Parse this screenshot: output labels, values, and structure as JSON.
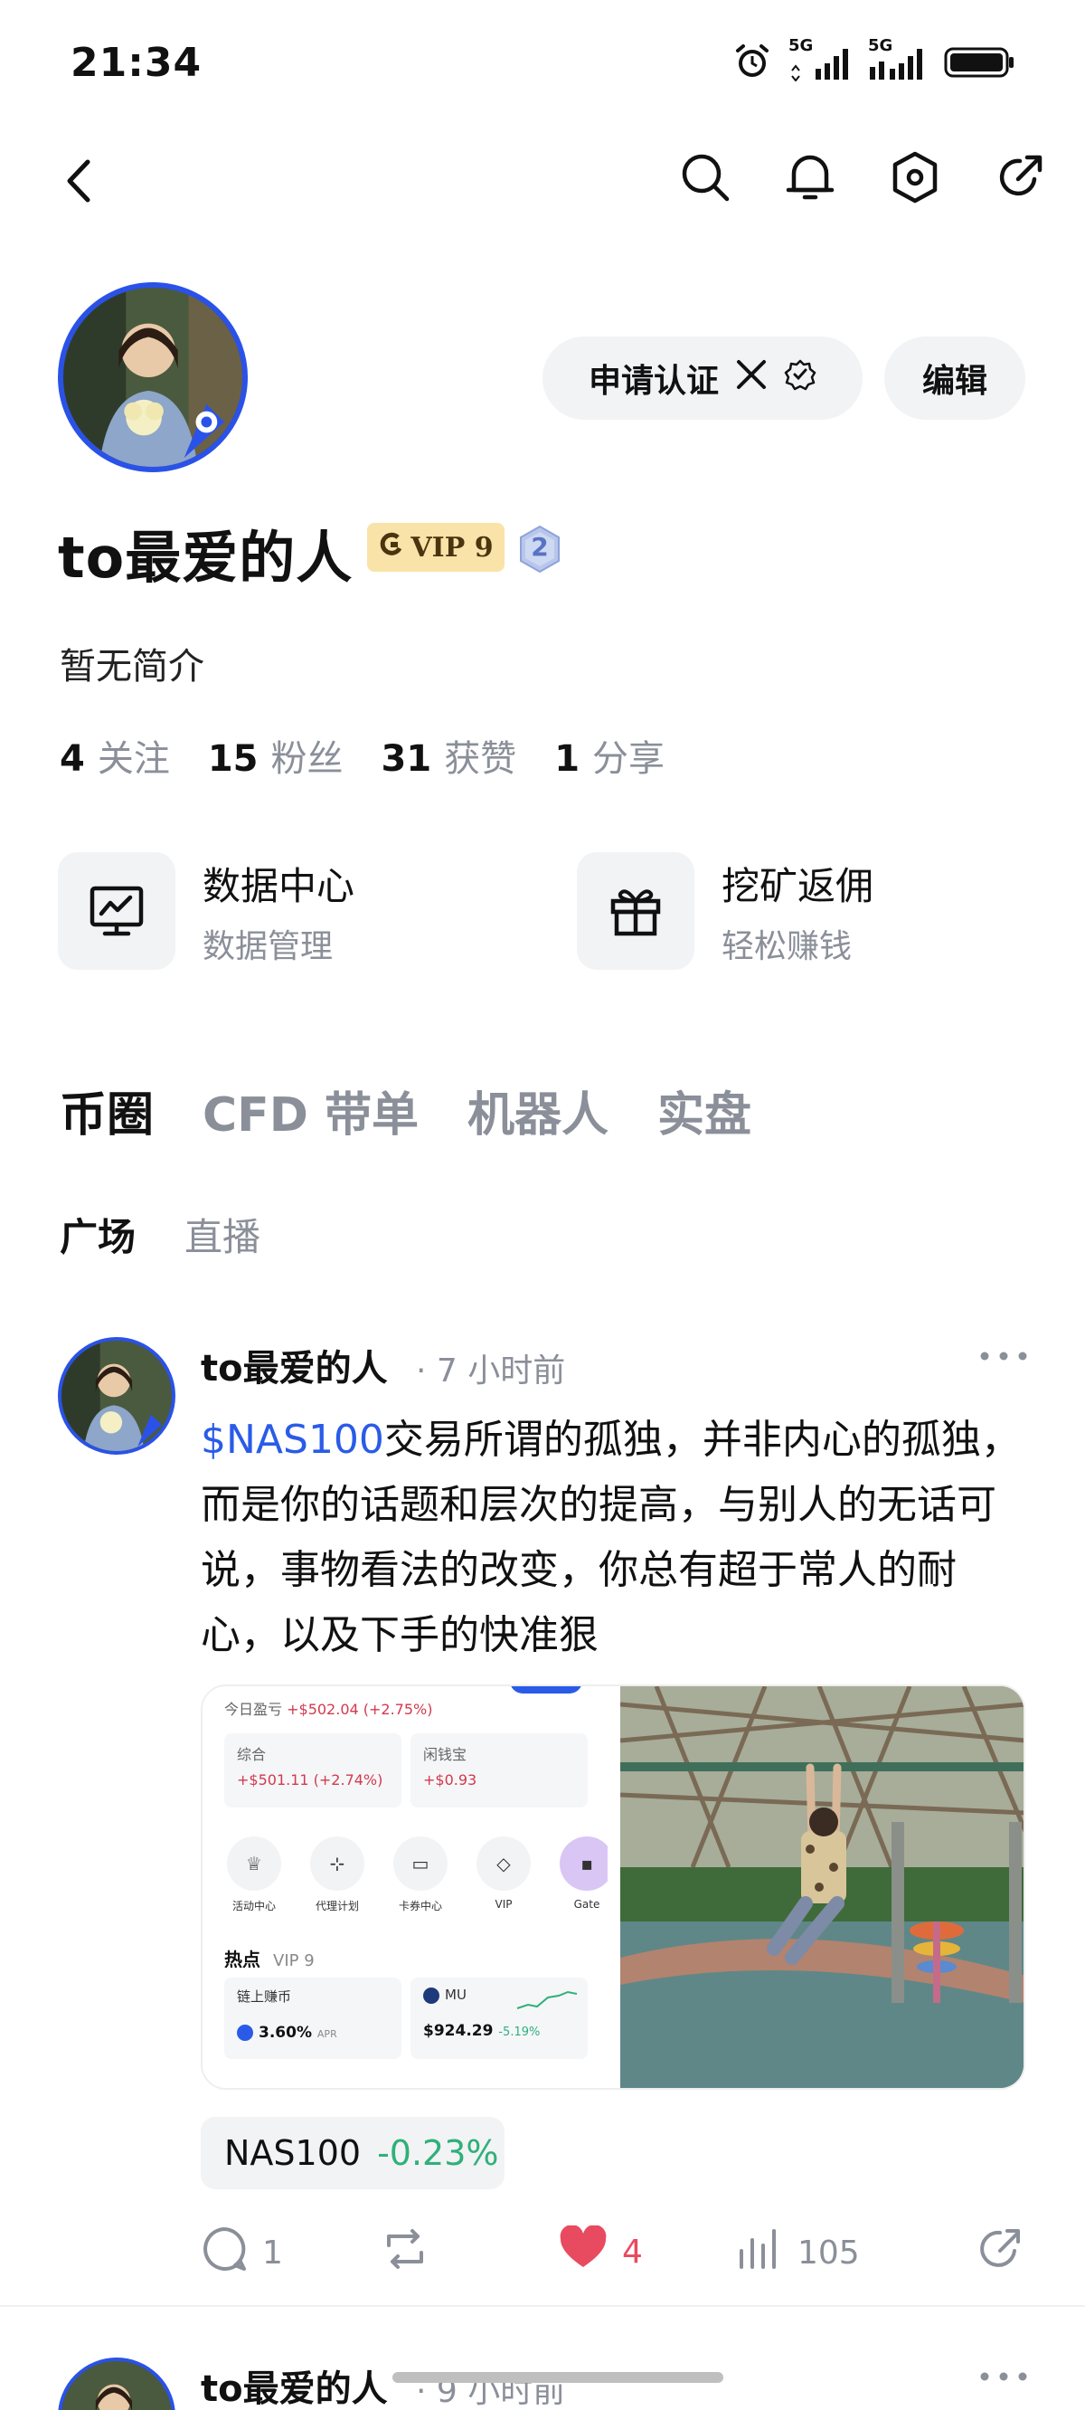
{
  "status_bar": {
    "time": "21:34",
    "signal_1_label": "5G",
    "signal_2_label": "5G"
  },
  "nav": {
    "icons": [
      "back-icon",
      "search-icon",
      "bell-icon",
      "settings-hex-icon",
      "share-icon"
    ]
  },
  "profile": {
    "name": "to最爱的人",
    "vip_label": "VIP 9",
    "level": "2",
    "bio": "暂无简介",
    "buttons": {
      "verify": "申请认证",
      "edit": "编辑"
    },
    "stats": [
      {
        "num": "4",
        "label": "关注"
      },
      {
        "num": "15",
        "label": "粉丝"
      },
      {
        "num": "31",
        "label": "获赞"
      },
      {
        "num": "1",
        "label": "分享"
      }
    ]
  },
  "tools": [
    {
      "title": "数据中心",
      "subtitle": "数据管理",
      "icon": "chart-monitor-icon"
    },
    {
      "title": "挖矿返佣",
      "subtitle": "轻松赚钱",
      "icon": "gift-icon"
    }
  ],
  "main_tabs": [
    "币圈",
    "CFD 带单",
    "机器人",
    "实盘"
  ],
  "sub_tabs": [
    "广场",
    "直播"
  ],
  "post": {
    "author": "to最爱的人",
    "time": "· 7 小时前",
    "ticker_link": "$NAS100",
    "text": "交易所谓的孤独，并非内心的孤独，而是你的话题和层次的提高，与别人的无话可说，事物看法的改变，你总有超于常人的耐心，以及下手的快准狠",
    "screenshot": {
      "pnl_label": "今日盈亏",
      "pnl_value": "+$502.04 (+2.75%)",
      "box1_label": "综合",
      "box1_value": "+$501.11 (+2.74%)",
      "box2_label": "闲钱宝",
      "box2_value": "+$0.93",
      "icons": [
        "活动中心",
        "代理计划",
        "卡券中心",
        "VIP",
        "Gate"
      ],
      "hot_label": "热点",
      "hot_vip": "VIP 9",
      "card1_title": "链上赚币",
      "card1_value": "3.60%",
      "card1_unit": "APR",
      "card2_title": "MU",
      "card2_value": "$924.29",
      "card2_change": "-5.19%"
    },
    "chip": {
      "symbol": "NAS100",
      "change": "-0.23%"
    },
    "actions": {
      "comments": "1",
      "likes": "4",
      "views": "105"
    }
  },
  "post2": {
    "author": "to最爱的人",
    "time": "· 9 小时前"
  },
  "colors": {
    "accent_blue": "#2a5be8",
    "avatar_ring": "#2a52e8",
    "vip_gold_bg": "#f9e3a8",
    "like_red": "#e84a5f",
    "positive_green": "#2fb07a",
    "muted_gray": "#8a8f99"
  }
}
